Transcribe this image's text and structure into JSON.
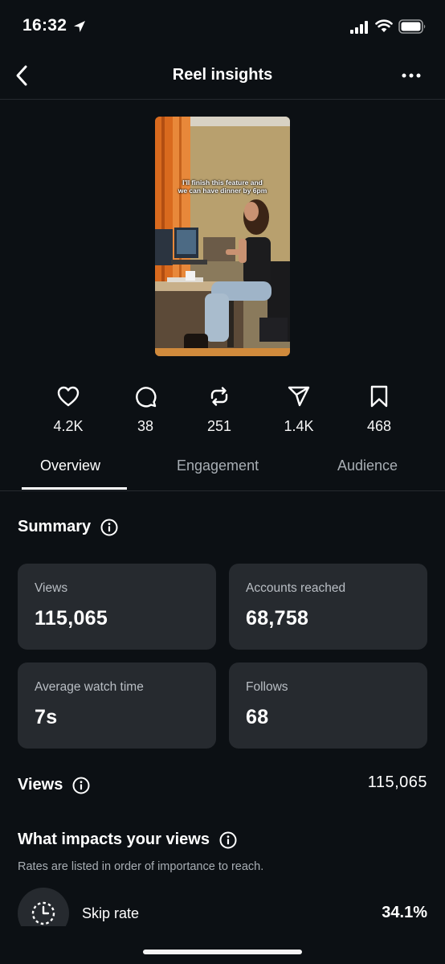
{
  "status_bar": {
    "time": "16:32"
  },
  "header": {
    "title": "Reel insights"
  },
  "reel": {
    "caption_line1": "I'll finish this feature and",
    "caption_line2": "we can have dinner by 6pm"
  },
  "metrics": [
    {
      "icon": "heart-icon",
      "value": "4.2K"
    },
    {
      "icon": "comment-icon",
      "value": "38"
    },
    {
      "icon": "repost-icon",
      "value": "251"
    },
    {
      "icon": "share-icon",
      "value": "1.4K"
    },
    {
      "icon": "bookmark-icon",
      "value": "468"
    }
  ],
  "tabs": [
    "Overview",
    "Engagement",
    "Audience"
  ],
  "summary": {
    "title": "Summary",
    "cards": [
      {
        "label": "Views",
        "value": "115,065"
      },
      {
        "label": "Accounts reached",
        "value": "68,758"
      },
      {
        "label": "Average watch time",
        "value": "7s"
      },
      {
        "label": "Follows",
        "value": "68"
      }
    ]
  },
  "views": {
    "title": "Views",
    "value": "115,065"
  },
  "impact": {
    "title": "What impacts your views",
    "subtitle": "Rates are listed in order of importance to reach.",
    "skip_rate": {
      "label": "Skip rate",
      "value": "34.1%"
    }
  },
  "colors": {
    "background": "#0c1014",
    "card": "#262a2f",
    "text": "#f5f5f5",
    "muted": "#a8aeb4"
  }
}
